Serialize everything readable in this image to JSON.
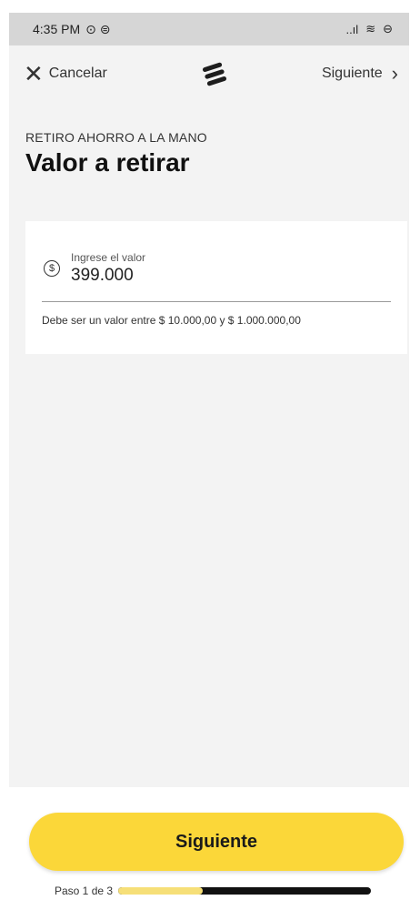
{
  "status_bar": {
    "time": "4:35 PM",
    "left_icons": "⊙ ⊜",
    "signal": "..ıl",
    "wifi": "≋",
    "battery": "⊖"
  },
  "topbar": {
    "cancel_label": "Cancelar",
    "next_label": "Siguiente",
    "logo_icon": "bank-logo-icon"
  },
  "header": {
    "subtitle": "RETIRO AHORRO A LA MANO",
    "title": "Valor a retirar"
  },
  "amount_field": {
    "icon": "dollar-icon",
    "label": "Ingrese el valor",
    "value": "399.000",
    "hint": "Debe ser un valor entre $ 10.000,00 y $ 1.000.000,00"
  },
  "footer": {
    "next_button_label": "Siguiente",
    "step_text": "Paso 1 de 3",
    "progress_fraction": 0.333
  },
  "colors": {
    "accent": "#fbd739",
    "progress_fill": "#f6df78",
    "progress_track": "#111111",
    "background": "#f3f3f3"
  }
}
